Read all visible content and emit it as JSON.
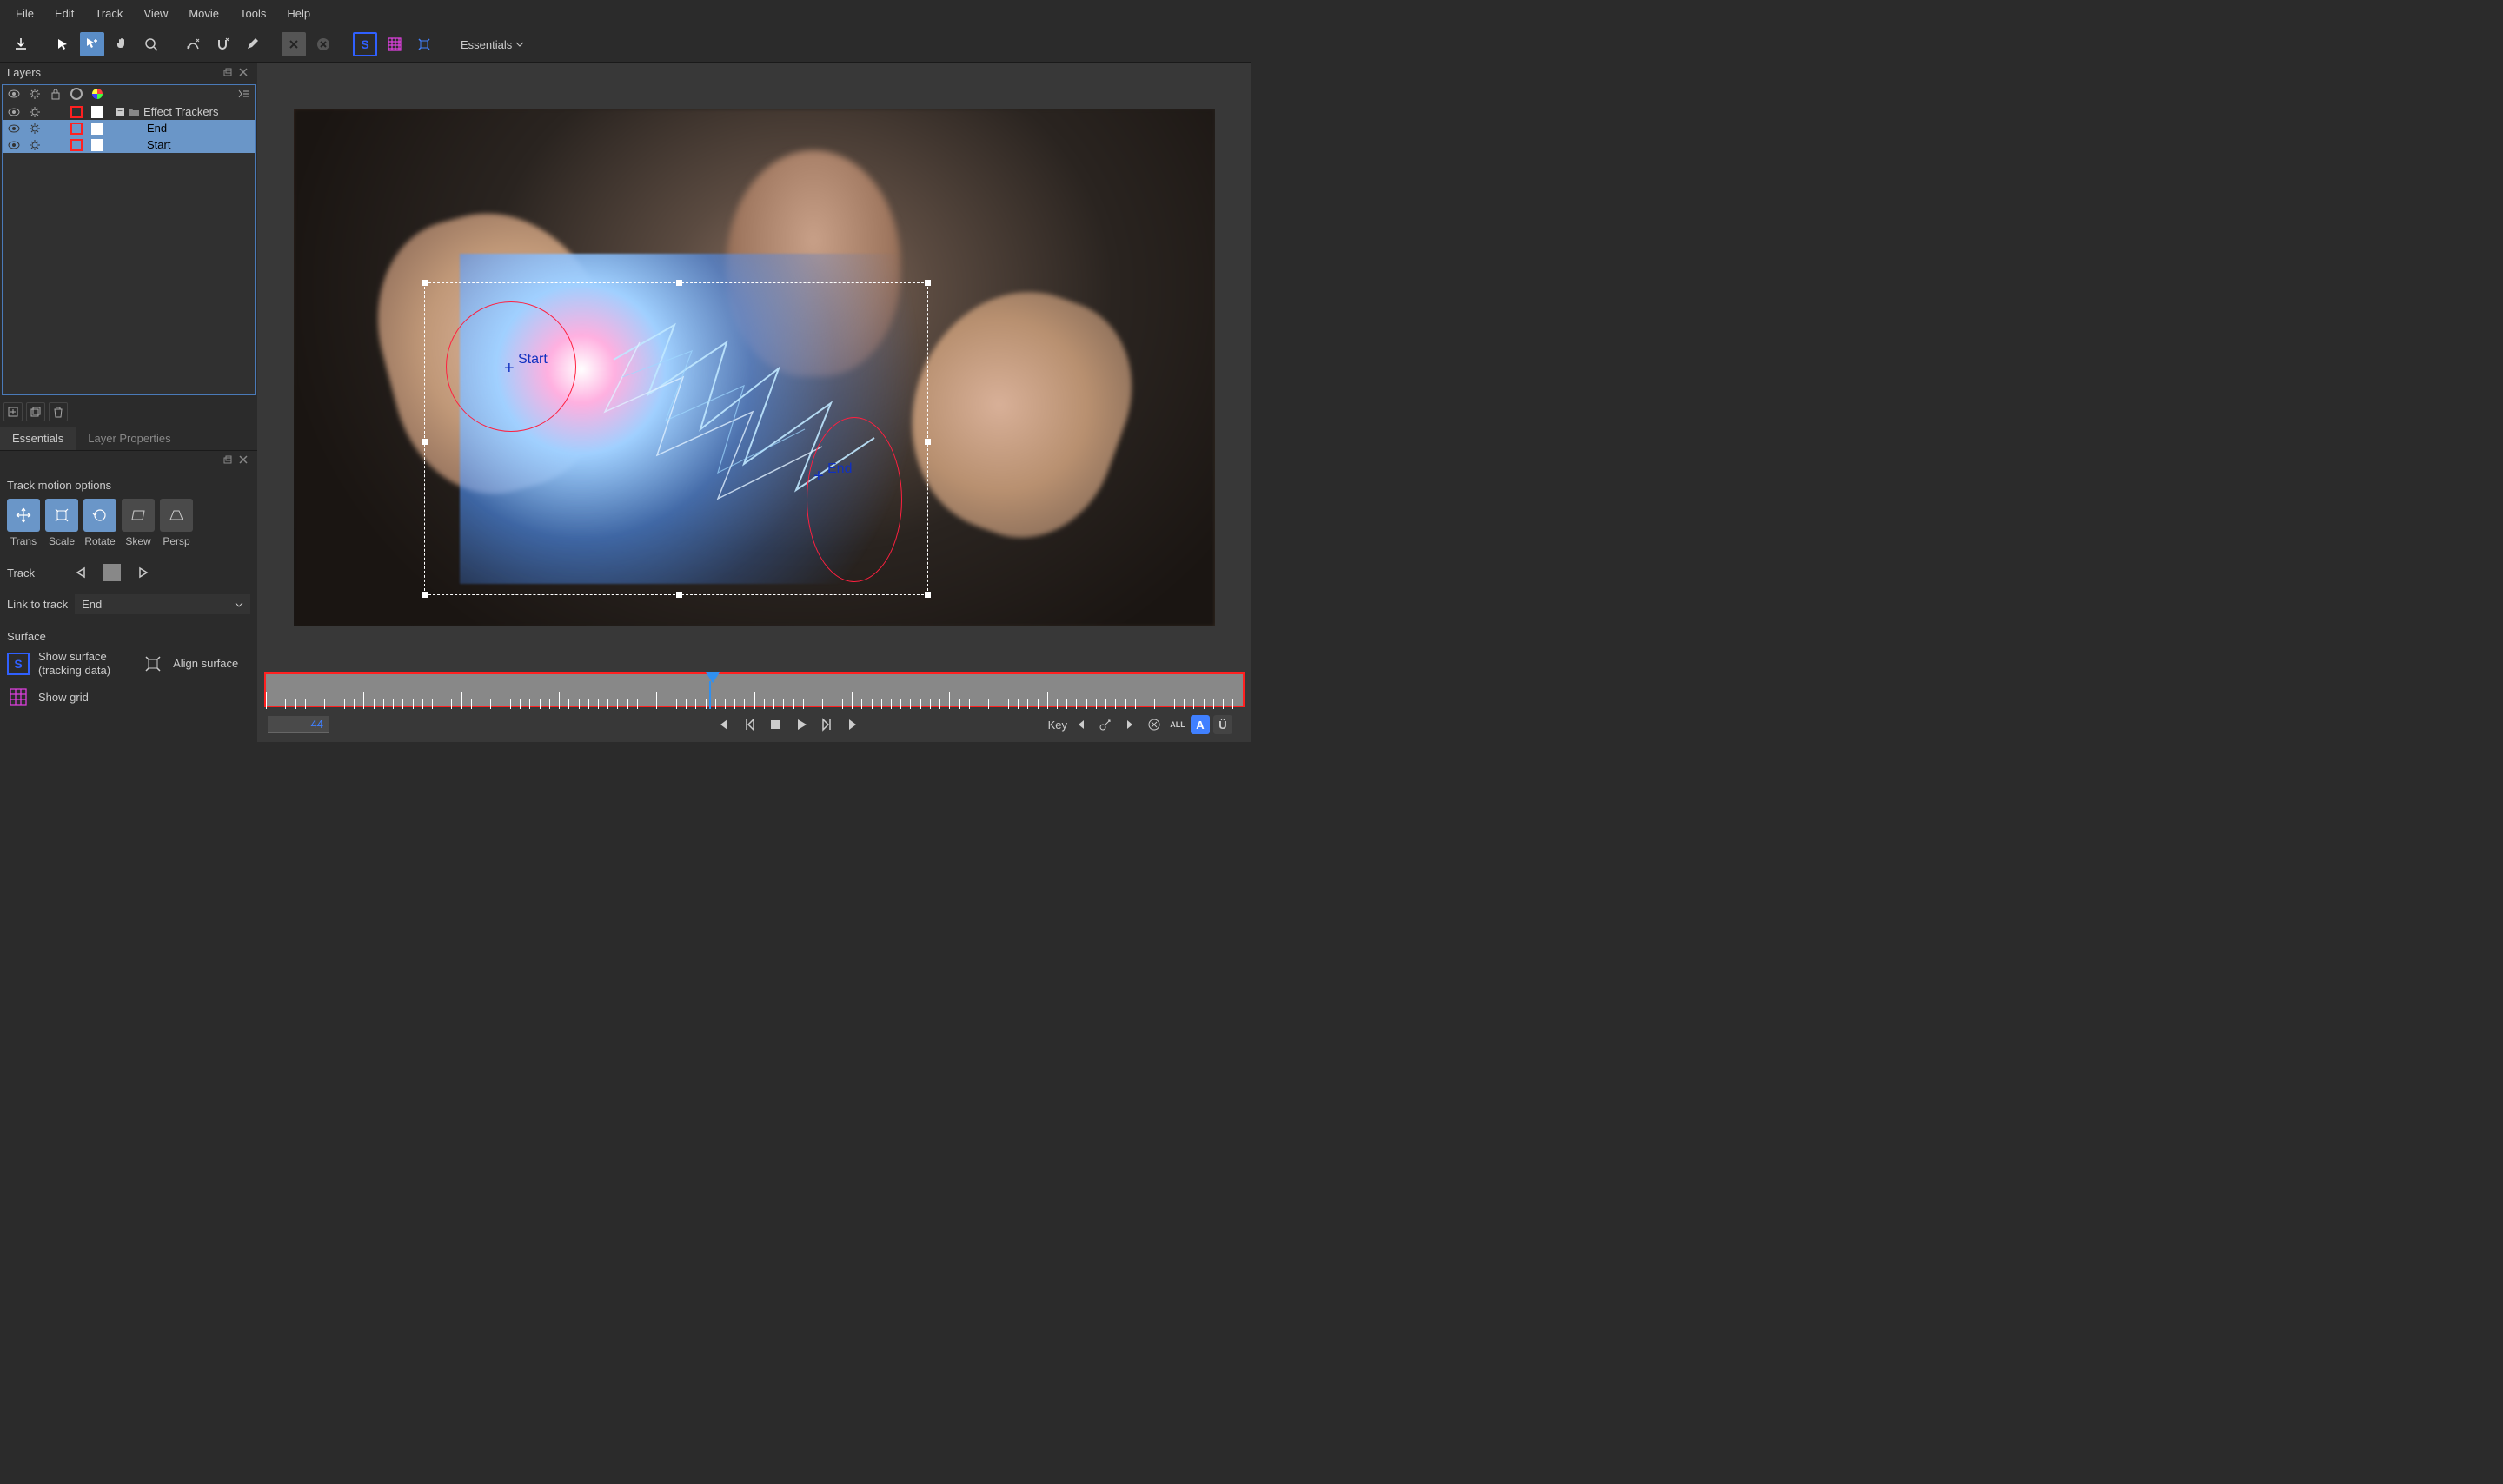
{
  "menu": {
    "items": [
      "File",
      "Edit",
      "Track",
      "View",
      "Movie",
      "Tools",
      "Help"
    ]
  },
  "toolbar": {
    "workspace": "Essentials"
  },
  "layers": {
    "title": "Layers",
    "group": "Effect Trackers",
    "items": [
      "End",
      "Start"
    ]
  },
  "tabs": {
    "essentials": "Essentials",
    "layerProps": "Layer Properties"
  },
  "motion": {
    "title": "Track motion options",
    "trans": "Trans",
    "scale": "Scale",
    "rotate": "Rotate",
    "skew": "Skew",
    "persp": "Persp"
  },
  "track": {
    "label": "Track"
  },
  "linkToTrack": {
    "label": "Link to track",
    "value": "End"
  },
  "surface": {
    "title": "Surface",
    "showSurface1": "Show surface",
    "showSurface2": "(tracking data)",
    "alignSurface": "Align surface",
    "showGrid": "Show grid"
  },
  "viewer": {
    "startLabel": "Start",
    "endLabel": "End"
  },
  "timeline": {
    "frame": "44"
  },
  "transport": {
    "keyLabel": "Key",
    "all": "ALL",
    "autoA": "A",
    "autoU": "Ü"
  }
}
